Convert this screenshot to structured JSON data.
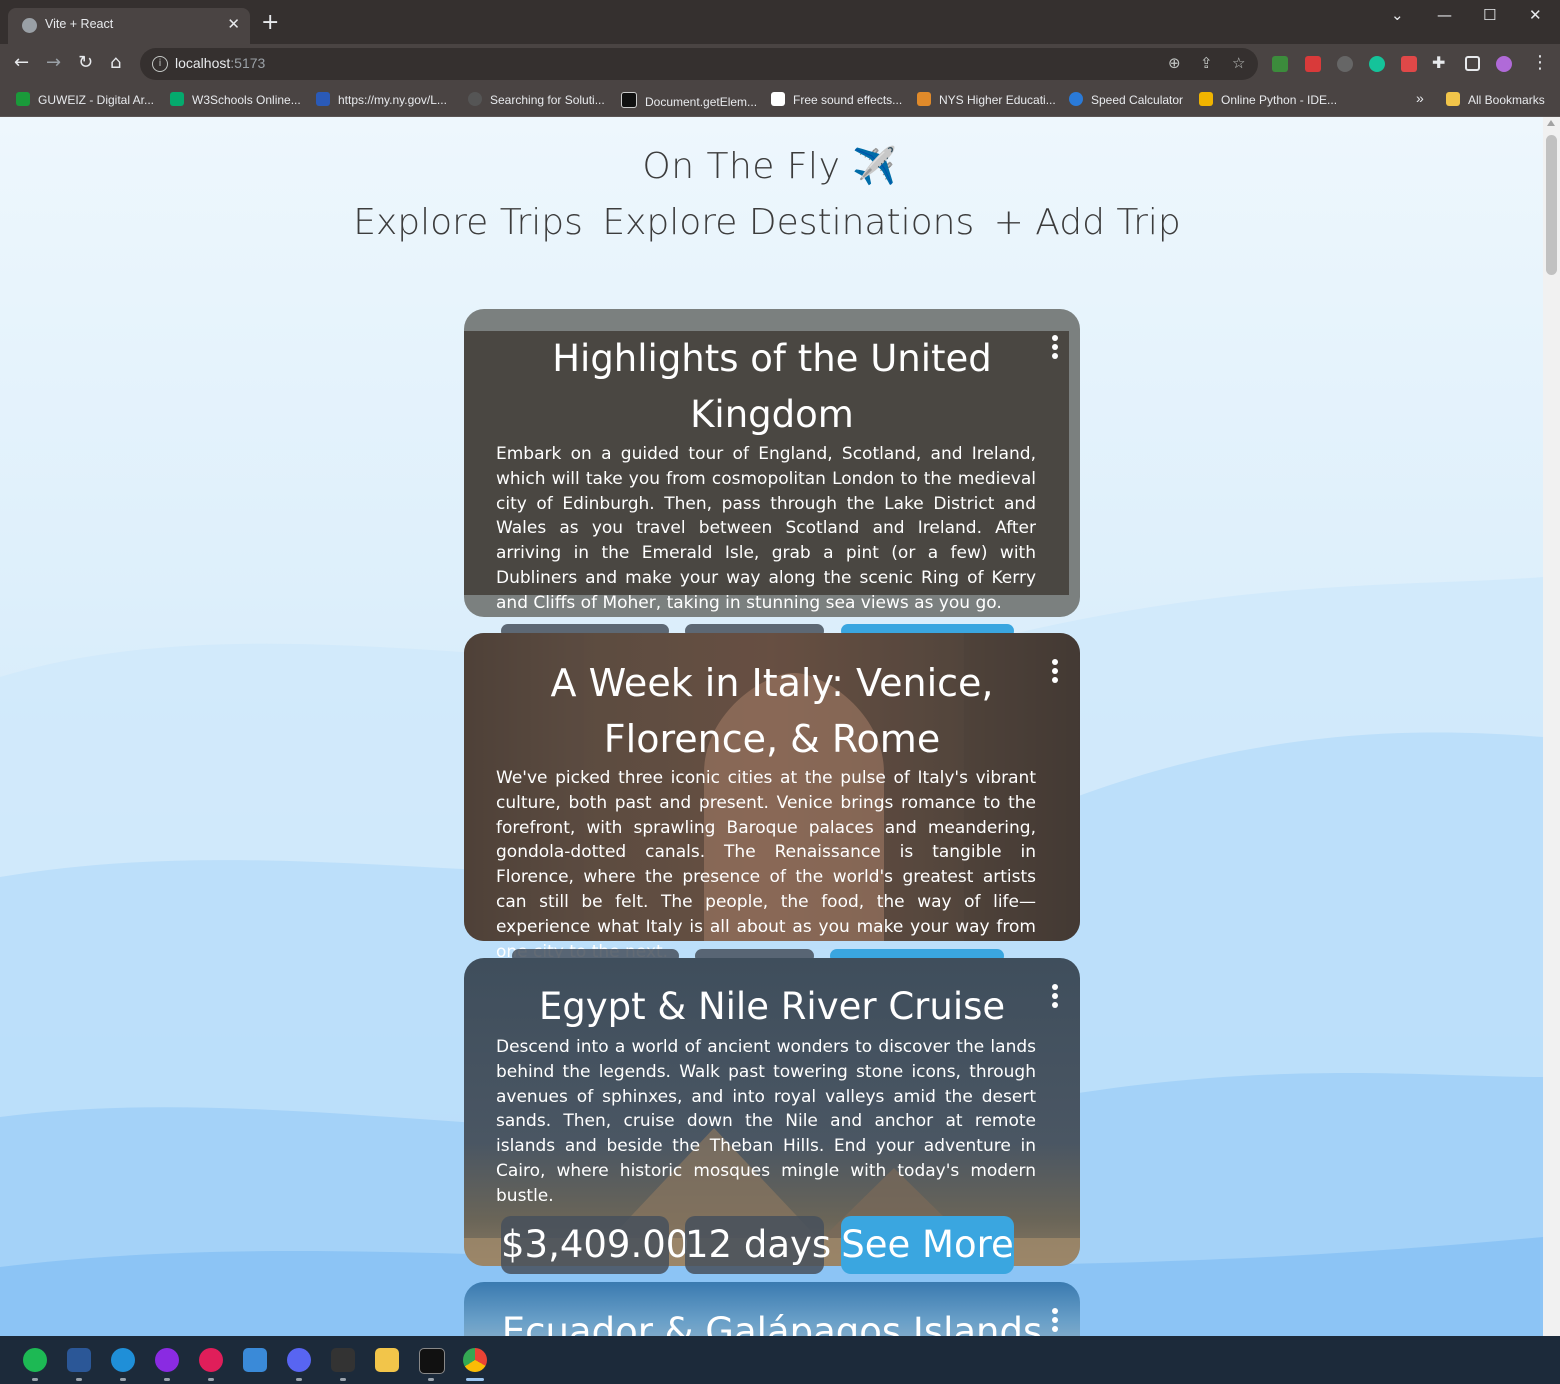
{
  "browser": {
    "tab_title": "Vite + React",
    "url_host": "localhost",
    "url_port": ":5173",
    "bookmarks": [
      "GUWEIZ - Digital Ar...",
      "W3Schools Online...",
      "https://my.ny.gov/L...",
      "Searching for Soluti...",
      "Document.getElem...",
      "Free sound effects...",
      "NYS Higher Educati...",
      "Speed Calculator",
      "Online Python - IDE..."
    ],
    "bookmarks_overflow": "»",
    "all_bookmarks": "All Bookmarks"
  },
  "site": {
    "title": "On The Fly ✈️",
    "nav": [
      "Explore Trips",
      "Explore Destinations",
      "+ Add Trip"
    ]
  },
  "trips": [
    {
      "title": "Highlights of the United Kingdom",
      "description": "Embark on a guided tour of England, Scotland, and Ireland, which will take you from cosmopolitan London to the medieval city of Edinburgh. Then, pass through the Lake District and Wales as you travel between Scotland and Ireland. After arriving in the Emerald Isle, grab a pint (or a few) with Dubliners and make your way along the scenic Ring of Kerry and Cliffs of Moher, taking in stunning sea views as you go."
    },
    {
      "title": "A Week in Italy: Venice, Florence, & Rome",
      "description": "We've picked three iconic cities at the pulse of Italy's vibrant culture, both past and present. Venice brings romance to the forefront, with sprawling Baroque palaces and meandering, gondola-dotted canals. The Renaissance is tangible in Florence, where the presence of the world's greatest artists can still be felt. The people, the food, the way of life—experience what Italy is all about as you make your way from one city to the next."
    },
    {
      "title": "Egypt & Nile River Cruise",
      "description": "Descend into a world of ancient wonders to discover the lands behind the legends. Walk past towering stone icons, through avenues of sphinxes, and into royal valleys amid the desert sands. Then, cruise down the Nile and anchor at remote islands and beside the Theban Hills. End your adventure in Cairo, where historic mosques mingle with today's modern bustle.",
      "price": "$3,409.00",
      "duration": "12 days",
      "cta": "See More"
    },
    {
      "title": "Ecuador & Galápagos Islands"
    }
  ]
}
